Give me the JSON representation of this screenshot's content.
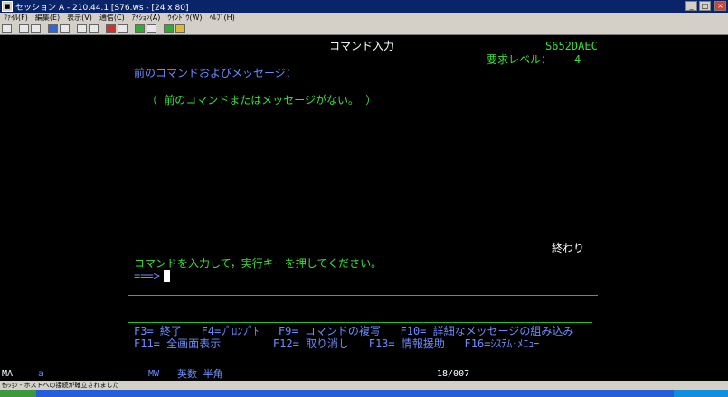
{
  "window": {
    "title": "セッション A - 210.44.1 [S76.ws - [24 x 80]",
    "buttons": [
      "_",
      "□",
      "×"
    ]
  },
  "menubar": [
    "ﾌｧｲﾙ(F)",
    "編集(E)",
    "表示(V)",
    "通信(C)",
    "ｱｸｼｮﾝ(A)",
    "ｳｲﾝﾄﾞｳ(W)",
    "ﾍﾙﾌﾟ(H)"
  ],
  "screen": {
    "title": "コマンド入力",
    "system_name": "S652DAEC",
    "request_level_label": "要求レベル：",
    "request_level_value": "4",
    "prev_heading": "前のコマンドおよびメッセージ：",
    "no_prev": "（ 前のコマンドまたはメッセージがない。 ）",
    "end_label": "終わり",
    "instruction": "コマンドを入力して，実行キーを押してください。",
    "prompt": "===>",
    "fkeys_line1": "F3= 終了   F4=ﾌﾟﾛﾝﾌﾟﾄ   F9= コマンドの複写   F10= 詳細なメッセージの組み込み",
    "fkeys_line2": "F11= 全画面表示        F12= 取り消し   F13= 情報援助   F16=ｼｽﾃﾑ･ﾒﾆｭｰ"
  },
  "oia": {
    "session_indicator": "MA",
    "field_a": "a",
    "mw": "MW",
    "input_mode": "英数 半角",
    "cursor_position": "18/007"
  },
  "statusbar": {
    "text": "ｾｯｼｮﾝ - ホストへの接続が確立されました"
  }
}
